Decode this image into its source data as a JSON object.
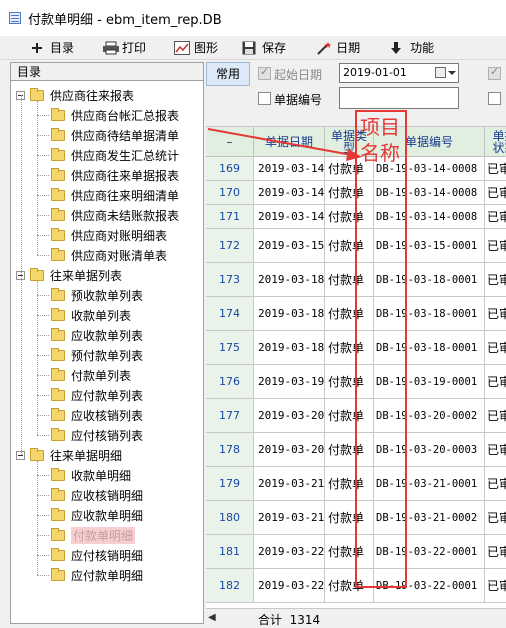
{
  "window": {
    "title": "付款单明细 - ebm_item_rep.DB"
  },
  "toolbar": {
    "items": [
      {
        "label": "目录",
        "icon": "plus-icon"
      },
      {
        "label": "打印",
        "icon": "printer-icon"
      },
      {
        "label": "图形",
        "icon": "chart-icon"
      },
      {
        "label": "保存",
        "icon": "floppy-icon"
      },
      {
        "label": "日期",
        "icon": "magic-wand-icon"
      },
      {
        "label": "功能",
        "icon": "arrow-down-icon"
      }
    ]
  },
  "sidebar": {
    "header": "目录",
    "groups": [
      {
        "label": "供应商往来报表",
        "items": [
          "供应商台帐汇总报表",
          "供应商待结单据清单",
          "供应商发生汇总统计",
          "供应商往来单据报表",
          "供应商往来明细清单",
          "供应商未结账款报表",
          "供应商对账明细表",
          "供应商对账清单表"
        ]
      },
      {
        "label": "往来单据列表",
        "items": [
          "预收款单列表",
          "收款单列表",
          "应收款单列表",
          "预付款单列表",
          "付款单列表",
          "应付款单列表",
          "应收核销列表",
          "应付核销列表"
        ]
      },
      {
        "label": "往来单据明细",
        "items": [
          "收款单明细",
          "应收核销明细",
          "应收款单明细",
          "付款单明细",
          "应付核销明细",
          "应付款单明细"
        ]
      }
    ],
    "selected": "付款单明细"
  },
  "filter": {
    "tab_label": "常用",
    "start_date_label": "起始日期",
    "start_date_value": "2019-01-01",
    "bill_no_label": "单据编号",
    "bill_no_value": ""
  },
  "grid": {
    "columns": [
      "–",
      "单据日期",
      "单据类型",
      "单据编号",
      "单据状态"
    ],
    "rows": [
      {
        "n": "169",
        "date": "2019-03-14",
        "type": "付款单",
        "no": "DB-19-03-14-0008",
        "state": "已审"
      },
      {
        "n": "170",
        "date": "2019-03-14",
        "type": "付款单",
        "no": "DB-19-03-14-0008",
        "state": "已审"
      },
      {
        "n": "171",
        "date": "2019-03-14",
        "type": "付款单",
        "no": "DB-19-03-14-0008",
        "state": "已审"
      },
      {
        "n": "172",
        "date": "2019-03-15",
        "type": "付款单",
        "no": "DB-19-03-15-0001",
        "state": "已审"
      },
      {
        "n": "173",
        "date": "2019-03-18",
        "type": "付款单",
        "no": "DB-19-03-18-0001",
        "state": "已审"
      },
      {
        "n": "174",
        "date": "2019-03-18",
        "type": "付款单",
        "no": "DB-19-03-18-0001",
        "state": "已审"
      },
      {
        "n": "175",
        "date": "2019-03-18",
        "type": "付款单",
        "no": "DB-19-03-18-0001",
        "state": "已审"
      },
      {
        "n": "176",
        "date": "2019-03-19",
        "type": "付款单",
        "no": "DB-19-03-19-0001",
        "state": "已审"
      },
      {
        "n": "177",
        "date": "2019-03-20",
        "type": "付款单",
        "no": "DB-19-03-20-0002",
        "state": "已审"
      },
      {
        "n": "178",
        "date": "2019-03-20",
        "type": "付款单",
        "no": "DB-19-03-20-0003",
        "state": "已审"
      },
      {
        "n": "179",
        "date": "2019-03-21",
        "type": "付款单",
        "no": "DB-19-03-21-0001",
        "state": "已审"
      },
      {
        "n": "180",
        "date": "2019-03-21",
        "type": "付款单",
        "no": "DB-19-03-21-0002",
        "state": "已审"
      },
      {
        "n": "181",
        "date": "2019-03-22",
        "type": "付款单",
        "no": "DB-19-03-22-0001",
        "state": "已审"
      },
      {
        "n": "182",
        "date": "2019-03-22",
        "type": "付款单",
        "no": "DB-19-03-22-0001",
        "state": "已审"
      }
    ],
    "total_label": "合计",
    "total_value": "1314"
  },
  "annotation": {
    "text_line1": "项目",
    "text_line2": "名称"
  },
  "colors": {
    "annotation": "#e53935",
    "grid_header": "#e0efe0",
    "selected_tree": "#f7cfd0"
  }
}
